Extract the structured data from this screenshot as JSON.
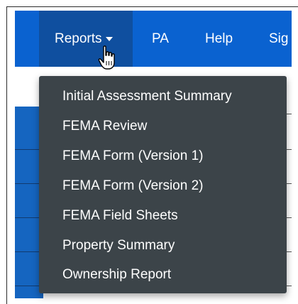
{
  "navbar": {
    "items": [
      {
        "label": "Reports",
        "active": true,
        "has_caret": true
      },
      {
        "label": "PA"
      },
      {
        "label": "Help"
      },
      {
        "label": "Sig"
      }
    ]
  },
  "dropdown": {
    "items": [
      {
        "label": "Initial Assessment Summary"
      },
      {
        "label": "FEMA Review"
      },
      {
        "label": "FEMA Form (Version 1)"
      },
      {
        "label": "FEMA Form (Version 2)"
      },
      {
        "label": "FEMA Field Sheets"
      },
      {
        "label": "Property Summary"
      },
      {
        "label": "Ownership Report"
      }
    ]
  },
  "colors": {
    "navbar_bg": "#0a62d0",
    "active_tab_bg": "#0f4f9f",
    "dropdown_bg": "#3c4449",
    "text": "#ffffff"
  },
  "icons": {
    "cursor": "hand-pointer-cursor-icon",
    "caret": "caret-down-icon"
  }
}
